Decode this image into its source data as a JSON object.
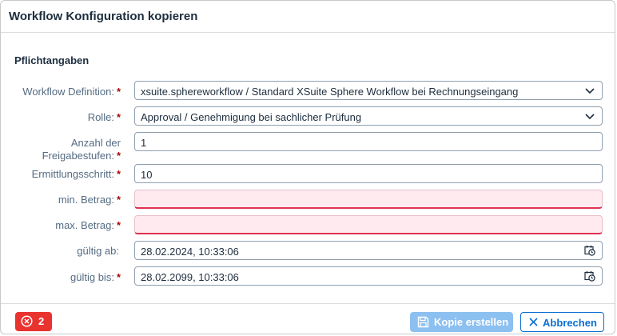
{
  "dialog": {
    "title": "Workflow Konfiguration kopieren",
    "section_title": "Pflichtangaben"
  },
  "fields": {
    "workflow_definition": {
      "label": "Workflow Definition:",
      "value": "xsuite.sphereworkflow / Standard XSuite Sphere Workflow bei Rechnungseingang"
    },
    "rolle": {
      "label": "Rolle:",
      "value": "Approval / Genehmigung bei sachlicher Prüfung"
    },
    "anzahl": {
      "label_line1": "Anzahl der",
      "label_line2": "Freigabestufen:",
      "value": "1"
    },
    "ermittlungsschritt": {
      "label": "Ermittlungsschritt:",
      "value": "10"
    },
    "min_betrag": {
      "label": "min. Betrag:",
      "value": ""
    },
    "max_betrag": {
      "label": "max. Betrag:",
      "value": ""
    },
    "gueltig_ab": {
      "label": "gültig ab:",
      "value": "28.02.2024, 10:33:06"
    },
    "gueltig_bis": {
      "label": "gültig bis:",
      "value": "28.02.2099, 10:33:06"
    }
  },
  "required_marker": "*",
  "footer": {
    "error_count": "2",
    "copy_label": "Kopie erstellen",
    "cancel_label": "Abbrechen"
  },
  "icons": {
    "dropdown": "chevron-down-icon",
    "date_time": "date-time-icon",
    "error": "error-circle-icon",
    "save": "save-icon",
    "cancel": "close-icon"
  },
  "colors": {
    "accent": "#0a6ed1",
    "error": "#e9332f",
    "required": "#aa0808",
    "error_field_bg": "#ffeaf0",
    "disabled_button": "#8cc0f0"
  }
}
